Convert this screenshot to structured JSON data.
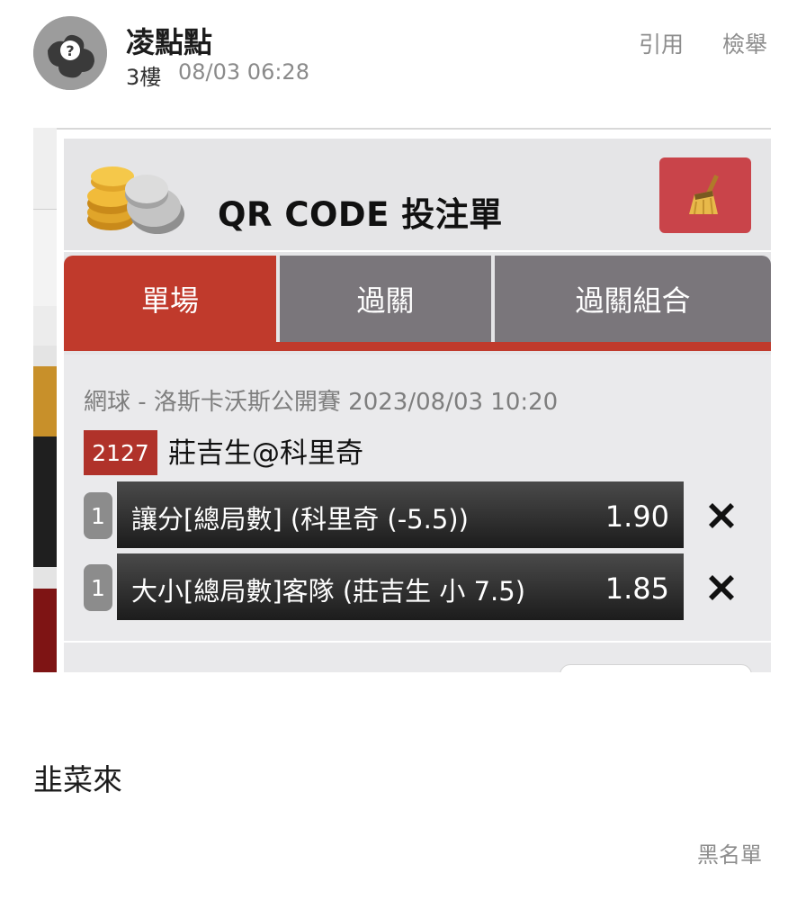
{
  "post": {
    "author": "凌點點",
    "floor": "3樓",
    "time": "08/03 06:28",
    "quote_label": "引用",
    "report_label": "檢舉",
    "message": "韭菜來",
    "blacklist_label": "黑名單"
  },
  "betslip": {
    "title": "QR CODE 投注單",
    "tabs": [
      {
        "label": "單場",
        "active": true
      },
      {
        "label": "過關",
        "active": false
      },
      {
        "label": "過關組合",
        "active": false
      }
    ],
    "event": "網球 - 洛斯卡沃斯公開賽 2023/08/03 10:20",
    "match_id": "2127",
    "match_name": "莊吉生@科里奇",
    "bets": [
      {
        "qty": "1",
        "selection": "讓分[總局數] (科里奇 (-5.5))",
        "odds": "1.90"
      },
      {
        "qty": "1",
        "selection": "大小[總局數]客隊 (莊吉生 小 7.5)",
        "odds": "1.85"
      }
    ]
  },
  "icons": {
    "avatar": "question-puzzle-avatar-icon",
    "coins": "coins-icon",
    "clear": "broom-icon",
    "remove": "close-x-icon"
  },
  "colors": {
    "accent_red": "#c03a2c",
    "clear_button": "#c9444a",
    "tab_inactive": "#7a767b",
    "muted_text": "#8d8d8d"
  }
}
